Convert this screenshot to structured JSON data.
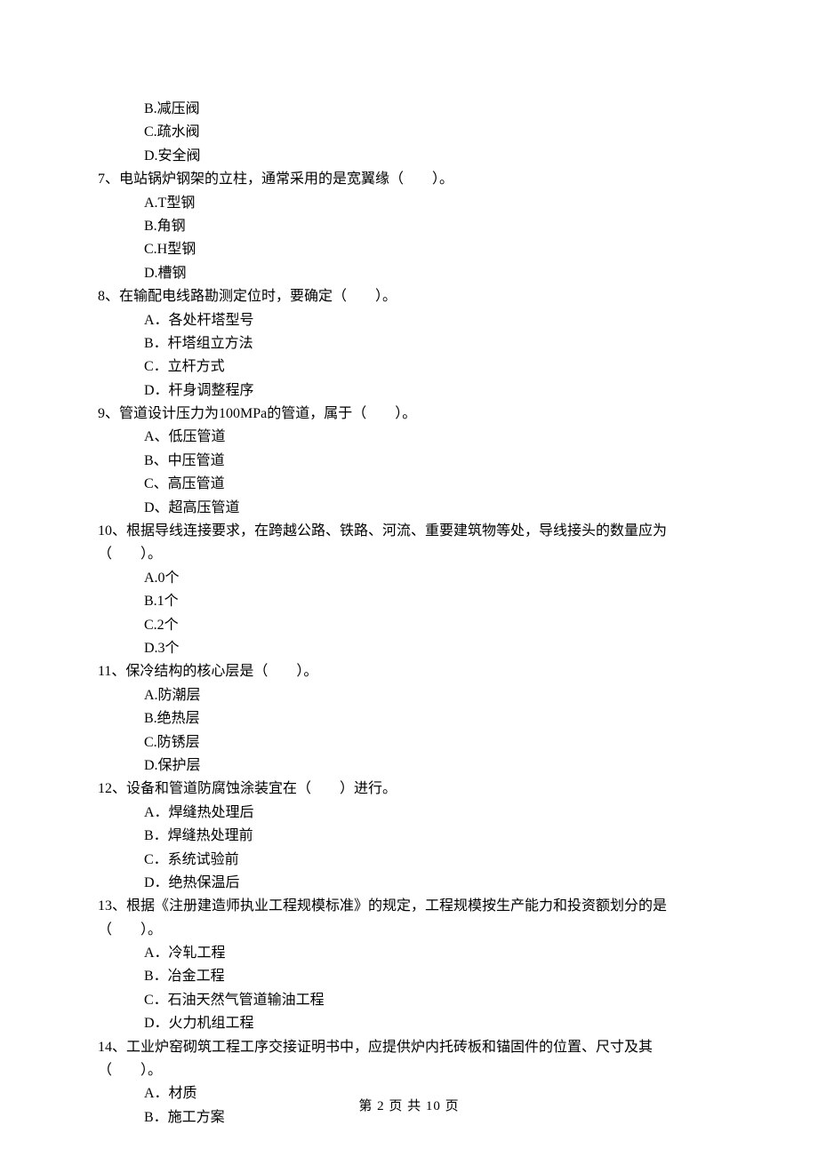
{
  "q6_options": {
    "b": "B.减压阀",
    "c": "C.疏水阀",
    "d": "D.安全阀"
  },
  "q7": {
    "stem": "7、电站锅炉钢架的立柱，通常采用的是宽翼缘（　　）。",
    "a": "A.T型钢",
    "b": "B.角钢",
    "c": "C.H型钢",
    "d": "D.槽钢"
  },
  "q8": {
    "stem": "8、在输配电线路勘测定位时，要确定（　　）。",
    "a": "A．各处杆塔型号",
    "b": "B．杆塔组立方法",
    "c": "C．立杆方式",
    "d": "D．杆身调整程序"
  },
  "q9": {
    "stem": "9、管道设计压力为100MPa的管道，属于（　　）。",
    "a": "A、低压管道",
    "b": "B、中压管道",
    "c": "C、高压管道",
    "d": "D、超高压管道"
  },
  "q10": {
    "stem": "10、根据导线连接要求，在跨越公路、铁路、河流、重要建筑物等处，导线接头的数量应为",
    "stem2": "（　　）。",
    "a": "A.0个",
    "b": "B.1个",
    "c": "C.2个",
    "d": "D.3个"
  },
  "q11": {
    "stem": "11、保冷结构的核心层是（　　）。",
    "a": "A.防潮层",
    "b": "B.绝热层",
    "c": "C.防锈层",
    "d": "D.保护层"
  },
  "q12": {
    "stem": "12、设备和管道防腐蚀涂装宜在（　　）进行。",
    "a": "A．焊缝热处理后",
    "b": "B．焊缝热处理前",
    "c": "C．系统试验前",
    "d": "D．绝热保温后"
  },
  "q13": {
    "stem": "13、根据《注册建造师执业工程规模标准》的规定，工程规模按生产能力和投资额划分的是",
    "stem2": "（　　）。",
    "a": "A．冷轧工程",
    "b": "B．冶金工程",
    "c": "C．石油天然气管道输油工程",
    "d": "D．火力机组工程"
  },
  "q14": {
    "stem": "14、工业炉窑砌筑工程工序交接证明书中，应提供炉内托砖板和锚固件的位置、尺寸及其",
    "stem2": "（　　）。",
    "a": "A．材质",
    "b": "B．施工方案"
  },
  "footer": "第 2 页 共 10 页"
}
